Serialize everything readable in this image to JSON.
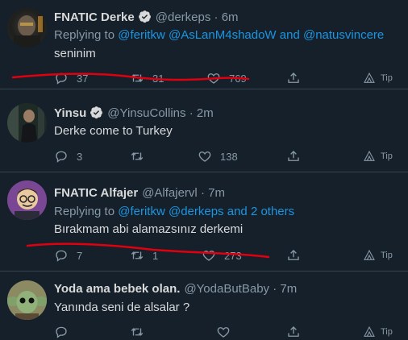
{
  "tweets": [
    {
      "display_name": "FNATIC Derke",
      "verified": true,
      "handle": "@derkeps",
      "dot": "·",
      "time": "6m",
      "replying_prefix": "Replying to",
      "mentions": [
        "@feritkw",
        "@AsLanM4shadoW"
      ],
      "joiner": "and",
      "last_mention": "@natusvincere",
      "text": "seninim",
      "replies": "37",
      "retweets": "31",
      "likes": "769",
      "tip": "Tip"
    },
    {
      "display_name": "Yinsu",
      "verified": true,
      "handle": "@YinsuCollins",
      "dot": "·",
      "time": "2m",
      "text": "Derke come to Turkey",
      "replies": "3",
      "retweets": "",
      "likes": "138",
      "tip": "Tip"
    },
    {
      "display_name": "FNATIC Alfajer",
      "verified": false,
      "handle": "@Alfajervl",
      "dot": "·",
      "time": "7m",
      "replying_prefix": "Replying to",
      "mentions": [
        "@feritkw",
        "@derkeps"
      ],
      "joiner": "and",
      "last_mention": "2 others",
      "text": "Bırakmam abi alamazsınız derkemi",
      "replies": "7",
      "retweets": "1",
      "likes": "273",
      "tip": "Tip"
    },
    {
      "display_name": "Yoda ama bebek olan.",
      "verified": false,
      "handle": "@YodaButBaby",
      "dot": "·",
      "time": "7m",
      "text": "Yanında seni de alsalar ?",
      "tip": "Tip"
    }
  ],
  "icons": {
    "reply": "reply-icon",
    "retweet": "retweet-icon",
    "like": "heart-icon",
    "share": "share-icon",
    "tip": "tip-icon",
    "verified": "verified-badge-icon"
  },
  "colors": {
    "background": "#15202b",
    "divider": "#38444d",
    "text": "#d9d9d9",
    "muted": "#8899a6",
    "link": "#1b95e0",
    "verified": "#d9d9d9",
    "annotation": "#e0000f"
  }
}
